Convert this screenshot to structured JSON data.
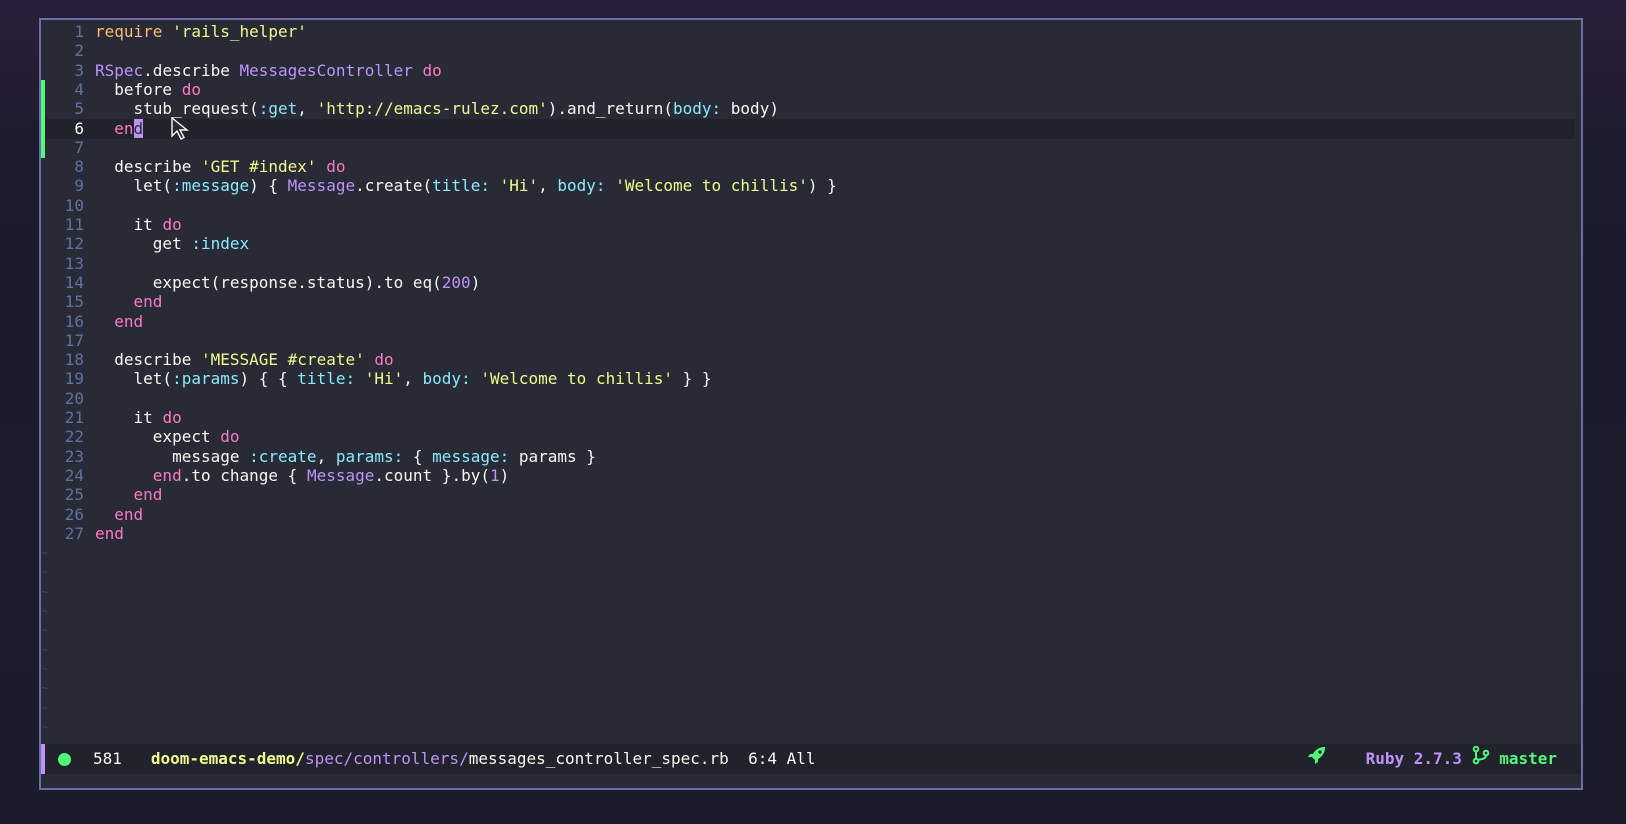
{
  "editor": {
    "current_line": 6,
    "lines": [
      {
        "n": "1",
        "tokens": [
          [
            "y",
            "require"
          ],
          [
            "p",
            " "
          ],
          [
            "s",
            "'rails_helper'"
          ]
        ]
      },
      {
        "n": "2",
        "tokens": []
      },
      {
        "n": "3",
        "tokens": [
          [
            "c",
            "RSpec"
          ],
          [
            "p",
            ".describe "
          ],
          [
            "c",
            "MessagesController"
          ],
          [
            "p",
            " "
          ],
          [
            "k",
            "do"
          ]
        ]
      },
      {
        "n": "4",
        "tokens": [
          [
            "p",
            "  before "
          ],
          [
            "k",
            "do"
          ]
        ]
      },
      {
        "n": "5",
        "tokens": [
          [
            "p",
            "    stub_request("
          ],
          [
            "sy",
            ":get"
          ],
          [
            "p",
            ", "
          ],
          [
            "s",
            "'http://emacs-rulez.com'"
          ],
          [
            "p",
            ").and_return("
          ],
          [
            "sy",
            "body:"
          ],
          [
            "p",
            " body)"
          ]
        ]
      },
      {
        "n": "6",
        "tokens": [
          [
            "p",
            "  "
          ],
          [
            "k",
            "en"
          ],
          [
            "cursor",
            "d"
          ]
        ]
      },
      {
        "n": "7",
        "tokens": []
      },
      {
        "n": "8",
        "tokens": [
          [
            "p",
            "  describe "
          ],
          [
            "s",
            "'GET #index'"
          ],
          [
            "p",
            " "
          ],
          [
            "k",
            "do"
          ]
        ]
      },
      {
        "n": "9",
        "tokens": [
          [
            "p",
            "    let("
          ],
          [
            "sy",
            ":message"
          ],
          [
            "p",
            ") { "
          ],
          [
            "c",
            "Message"
          ],
          [
            "p",
            ".create("
          ],
          [
            "sy",
            "title:"
          ],
          [
            "p",
            " "
          ],
          [
            "s",
            "'Hi'"
          ],
          [
            "p",
            ", "
          ],
          [
            "sy",
            "body:"
          ],
          [
            "p",
            " "
          ],
          [
            "s",
            "'Welcome to chillis'"
          ],
          [
            "p",
            ") }"
          ]
        ]
      },
      {
        "n": "10",
        "tokens": []
      },
      {
        "n": "11",
        "tokens": [
          [
            "p",
            "    it "
          ],
          [
            "k",
            "do"
          ]
        ]
      },
      {
        "n": "12",
        "tokens": [
          [
            "p",
            "      get "
          ],
          [
            "sy",
            ":index"
          ]
        ]
      },
      {
        "n": "13",
        "tokens": []
      },
      {
        "n": "14",
        "tokens": [
          [
            "p",
            "      expect(response.status).to eq("
          ],
          [
            "n",
            "200"
          ],
          [
            "p",
            ")"
          ]
        ]
      },
      {
        "n": "15",
        "tokens": [
          [
            "p",
            "    "
          ],
          [
            "k",
            "end"
          ]
        ]
      },
      {
        "n": "16",
        "tokens": [
          [
            "p",
            "  "
          ],
          [
            "k",
            "end"
          ]
        ]
      },
      {
        "n": "17",
        "tokens": []
      },
      {
        "n": "18",
        "tokens": [
          [
            "p",
            "  describe "
          ],
          [
            "s",
            "'MESSAGE #create'"
          ],
          [
            "p",
            " "
          ],
          [
            "k",
            "do"
          ]
        ]
      },
      {
        "n": "19",
        "tokens": [
          [
            "p",
            "    let("
          ],
          [
            "sy",
            ":params"
          ],
          [
            "p",
            ") { { "
          ],
          [
            "sy",
            "title:"
          ],
          [
            "p",
            " "
          ],
          [
            "s",
            "'Hi'"
          ],
          [
            "p",
            ", "
          ],
          [
            "sy",
            "body:"
          ],
          [
            "p",
            " "
          ],
          [
            "s",
            "'Welcome to chillis'"
          ],
          [
            "p",
            " } }"
          ]
        ]
      },
      {
        "n": "20",
        "tokens": []
      },
      {
        "n": "21",
        "tokens": [
          [
            "p",
            "    it "
          ],
          [
            "k",
            "do"
          ]
        ]
      },
      {
        "n": "22",
        "tokens": [
          [
            "p",
            "      expect "
          ],
          [
            "k",
            "do"
          ]
        ]
      },
      {
        "n": "23",
        "tokens": [
          [
            "p",
            "        message "
          ],
          [
            "sy",
            ":create"
          ],
          [
            "p",
            ", "
          ],
          [
            "sy",
            "params:"
          ],
          [
            "p",
            " { "
          ],
          [
            "sy",
            "message:"
          ],
          [
            "p",
            " params }"
          ]
        ]
      },
      {
        "n": "24",
        "tokens": [
          [
            "p",
            "      "
          ],
          [
            "k",
            "end"
          ],
          [
            "p",
            ".to change { "
          ],
          [
            "c",
            "Message"
          ],
          [
            "p",
            ".count }.by("
          ],
          [
            "n",
            "1"
          ],
          [
            "p",
            ")"
          ]
        ]
      },
      {
        "n": "25",
        "tokens": [
          [
            "p",
            "    "
          ],
          [
            "k",
            "end"
          ]
        ]
      },
      {
        "n": "26",
        "tokens": [
          [
            "p",
            "  "
          ],
          [
            "k",
            "end"
          ]
        ]
      },
      {
        "n": "27",
        "tokens": [
          [
            "k",
            "end"
          ]
        ]
      }
    ],
    "modified_lines": [
      4,
      5,
      6,
      7
    ],
    "tilde_char": "~"
  },
  "modeline": {
    "buffer_size": "581",
    "path_root": "doom-emacs-demo/",
    "path_dir": "spec/controllers/",
    "file_name": "messages_controller_spec.rb",
    "position": "6:4 All",
    "major_mode": "Ruby 2.7.3",
    "branch": "master"
  },
  "colors": {
    "background": "#282a36",
    "keyword": "#ff79c6",
    "string": "#f1fa8c",
    "symbol": "#8be9fd",
    "constant": "#bd93f9",
    "git_added": "#50fa7b"
  },
  "icons": {
    "status": "green-dot-icon",
    "rocket": "rocket-icon",
    "vcs": "git-branch-icon"
  }
}
